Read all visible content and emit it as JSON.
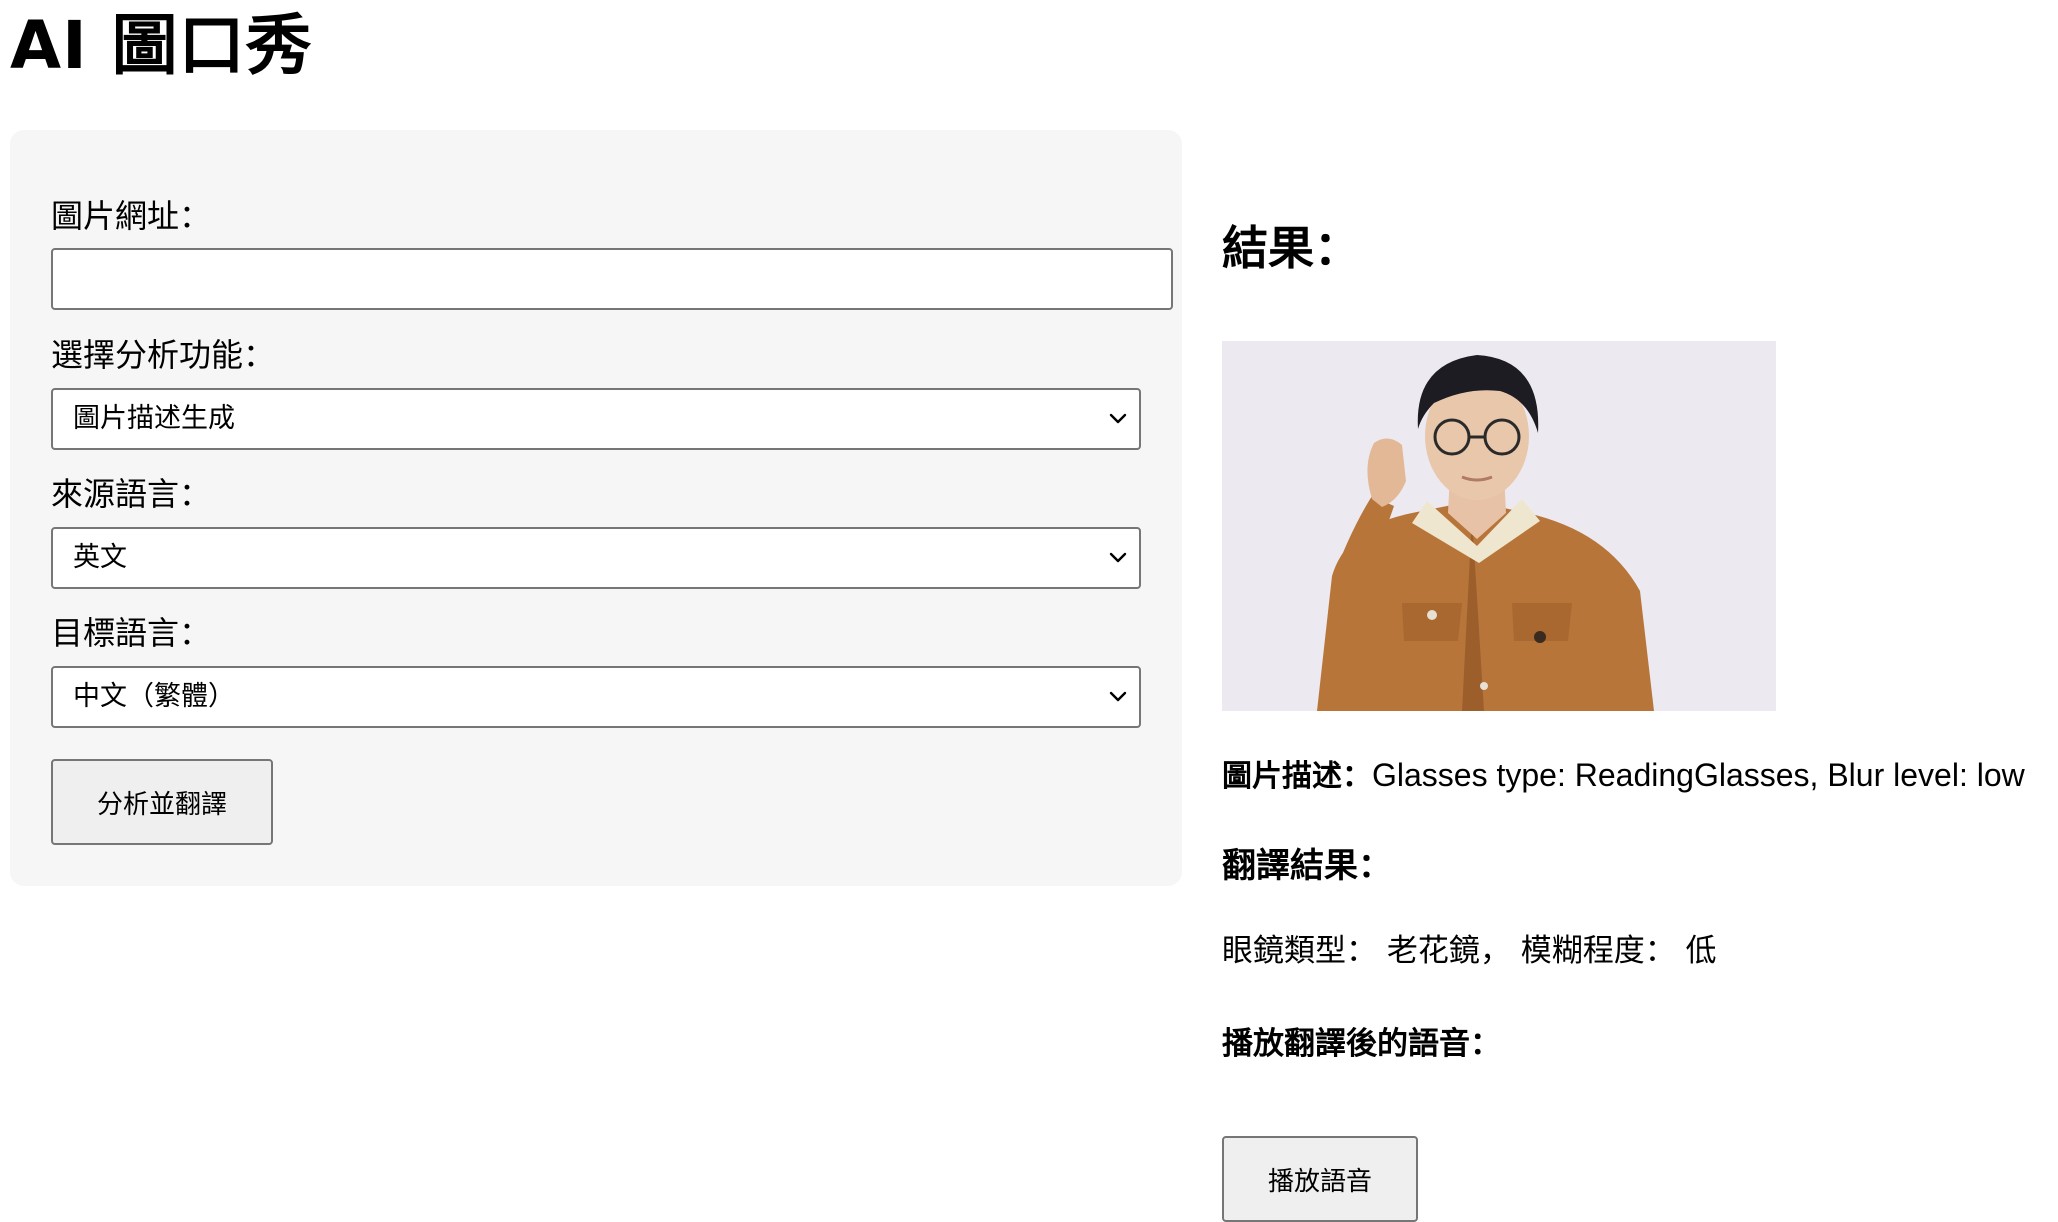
{
  "header": {
    "title": "AI 圖口秀"
  },
  "form": {
    "image_url_label": "圖片網址：",
    "image_url_value": "",
    "feature_label": "選擇分析功能：",
    "feature_selected": "圖片描述生成",
    "source_lang_label": "來源語言：",
    "source_lang_selected": "英文",
    "target_lang_label": "目標語言：",
    "target_lang_selected": "中文（繁體）",
    "submit_label": "分析並翻譯"
  },
  "result": {
    "heading": "結果：",
    "description_label": "圖片描述：",
    "description_text": "Glasses type: ReadingGlasses, Blur level: low",
    "translation_heading": "翻譯結果：",
    "translation_text": "眼鏡類型： 老花鏡， 模糊程度： 低",
    "audio_heading": "播放翻譯後的語音：",
    "play_label": "播放語音"
  },
  "colors": {
    "panel_bg": "#f6f6f6",
    "border": "#767676",
    "button_bg": "#efefef",
    "jacket": "#b8753a",
    "photo_bg": "#eceaf0"
  }
}
